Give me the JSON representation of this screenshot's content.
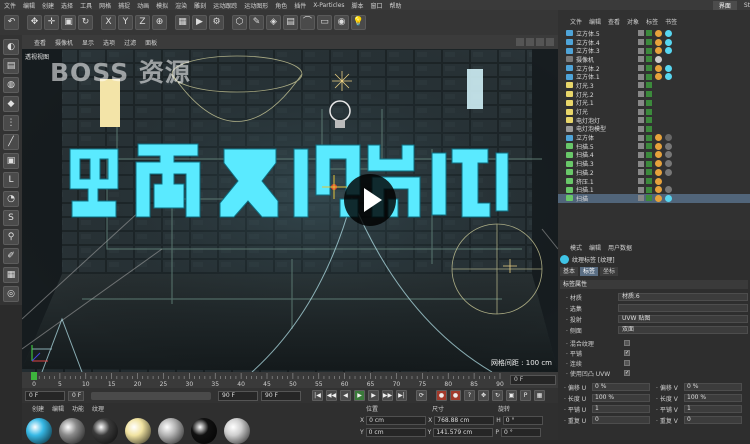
{
  "menubar": {
    "items": [
      "文件",
      "编辑",
      "创建",
      "选择",
      "工具",
      "网格",
      "捕捉",
      "动画",
      "模拟",
      "渲染",
      "雕刻",
      "运动跟踪",
      "运动图形",
      "角色",
      "插件",
      "X-Particles",
      "脚本",
      "窗口",
      "帮助"
    ],
    "layout_label": "界面",
    "layout_value": "St"
  },
  "toolbar": {
    "icons": [
      "undo-icon",
      "select-icon",
      "move-icon",
      "scale-icon",
      "rotate-icon",
      "axis-x-icon",
      "axis-y-icon",
      "axis-z-icon",
      "coordinate-icon",
      "render-region-icon",
      "render-view-icon",
      "render-settings-icon",
      "cube-icon",
      "spline-pen-icon",
      "subdivision-icon",
      "array-icon",
      "deformer-icon",
      "floor-icon",
      "camera-icon",
      "light-icon"
    ],
    "glyphs": [
      "↶",
      "✥",
      "✛",
      "▣",
      "↻",
      "X",
      "Y",
      "Z",
      "⊕",
      "▦",
      "▶",
      "⚙",
      "⬡",
      "✎",
      "◈",
      "▤",
      "⌒",
      "▭",
      "◉",
      "💡"
    ]
  },
  "left_tools": {
    "icons": [
      "make-editable-icon",
      "model-mode-icon",
      "texture-mode-icon",
      "workplane-icon",
      "points-mode-icon",
      "edges-mode-icon",
      "polygons-mode-icon",
      "axis-mode-icon",
      "tweak-icon",
      "snap-icon",
      "lock-workplane-icon",
      "paint-icon",
      "grid-icon",
      "solo-icon"
    ],
    "glyphs": [
      "◐",
      "▤",
      "◍",
      "◆",
      "⋮",
      "╱",
      "▣",
      "L",
      "◔",
      "S",
      "⚲",
      "✐",
      "▦",
      "◎"
    ]
  },
  "viewport": {
    "menu": [
      "查看",
      "摄像机",
      "显示",
      "选项",
      "过滤",
      "面板"
    ],
    "view_name": "透视视图",
    "watermark": "BOSS 资源",
    "title_text": "电商视觉",
    "grid_info": "网格间距 : 100 cm"
  },
  "timeline": {
    "ticks": [
      "0",
      "5",
      "10",
      "15",
      "20",
      "25",
      "30",
      "35",
      "40",
      "45",
      "50",
      "55",
      "60",
      "65",
      "70",
      "75",
      "80",
      "85",
      "90"
    ],
    "current_frame": "0 F"
  },
  "transport": {
    "start": "0 F",
    "preview_start": "0 F",
    "end": "90 F",
    "preview_end": "90 F"
  },
  "material_manager": {
    "menu": [
      "创建",
      "编辑",
      "功能",
      "纹理"
    ],
    "materials": [
      {
        "name": "cyan-glow-material",
        "color": "#37b9e6"
      },
      {
        "name": "gray-material",
        "color": "#8a8a8a"
      },
      {
        "name": "dark-metal-material",
        "color": "#3a3a3a"
      },
      {
        "name": "pale-yellow-material",
        "color": "#f1e3a1"
      },
      {
        "name": "chrome-material",
        "color": "#b5b5b5"
      },
      {
        "name": "black-material",
        "color": "#111111"
      },
      {
        "name": "silver-material",
        "color": "#cfcfcf"
      }
    ]
  },
  "coordinates": {
    "headers": [
      "位置",
      "尺寸",
      "旋转"
    ],
    "rows": [
      {
        "axis": "X",
        "pos": "0 cm",
        "size": "768.88 cm",
        "rot_axis": "H",
        "rot": "0 °"
      },
      {
        "axis": "Y",
        "pos": "0 cm",
        "size": "141.579 cm",
        "rot_axis": "P",
        "rot": "0 °"
      }
    ]
  },
  "object_manager": {
    "menu": [
      "文件",
      "编辑",
      "查看",
      "对象",
      "标签",
      "书签"
    ],
    "objects": [
      {
        "name": "立方体.5",
        "icon_color": "#4fa4d8",
        "tags": [
          "#e6a23c",
          "#58d6f0"
        ],
        "selected": false
      },
      {
        "name": "立方体.4",
        "icon_color": "#4fa4d8",
        "tags": [
          "#e6a23c",
          "#58d6f0"
        ],
        "selected": false
      },
      {
        "name": "立方体.3",
        "icon_color": "#4fa4d8",
        "tags": [
          "#e6a23c",
          "#58d6f0"
        ],
        "selected": false
      },
      {
        "name": "摄像机",
        "icon_color": "#7a7a7a",
        "tags": [
          "#cccccc"
        ],
        "selected": false
      },
      {
        "name": "立方体.2",
        "icon_color": "#4fa4d8",
        "tags": [
          "#e6a23c",
          "#58d6f0"
        ],
        "selected": false
      },
      {
        "name": "立方体.1",
        "icon_color": "#4fa4d8",
        "tags": [
          "#e6a23c",
          "#58d6f0"
        ],
        "selected": false
      },
      {
        "name": "灯光.3",
        "icon_color": "#e8d66a",
        "tags": [],
        "selected": false
      },
      {
        "name": "灯光.2",
        "icon_color": "#e8d66a",
        "tags": [],
        "selected": false
      },
      {
        "name": "灯光.1",
        "icon_color": "#e8d66a",
        "tags": [],
        "selected": false
      },
      {
        "name": "灯光",
        "icon_color": "#e8d66a",
        "tags": [],
        "selected": false
      },
      {
        "name": "电灯泡灯",
        "icon_color": "#e8d66a",
        "tags": [],
        "selected": false
      },
      {
        "name": "电灯泡模型",
        "icon_color": "#9a9a9a",
        "tags": [],
        "selected": false
      },
      {
        "name": "立方体",
        "icon_color": "#4fa4d8",
        "tags": [
          "#e6a23c",
          "#666666"
        ],
        "selected": false
      },
      {
        "name": "扫描.5",
        "icon_color": "#69c869",
        "tags": [
          "#e6a23c",
          "#777777"
        ],
        "selected": false
      },
      {
        "name": "扫描.4",
        "icon_color": "#69c869",
        "tags": [
          "#e6a23c",
          "#777777"
        ],
        "selected": false
      },
      {
        "name": "扫描.3",
        "icon_color": "#69c869",
        "tags": [
          "#e6a23c",
          "#777777"
        ],
        "selected": false
      },
      {
        "name": "扫描.2",
        "icon_color": "#69c869",
        "tags": [
          "#e6a23c",
          "#777777"
        ],
        "selected": false
      },
      {
        "name": "挤压.1",
        "icon_color": "#69c869",
        "tags": [
          "#e6a23c"
        ],
        "selected": false
      },
      {
        "name": "扫描.1",
        "icon_color": "#69c869",
        "tags": [
          "#e6a23c",
          "#777777"
        ],
        "selected": false
      },
      {
        "name": "扫描",
        "icon_color": "#69c869",
        "tags": [
          "#e6a23c",
          "#58d6f0"
        ],
        "selected": true
      }
    ]
  },
  "attribute_manager": {
    "menu": [
      "模式",
      "编辑",
      "用户数据"
    ],
    "title": "纹理标签 [纹理]",
    "tabs": [
      "基本",
      "标签",
      "坐标"
    ],
    "active_tab": "标签",
    "section": "标签属性",
    "rows": [
      {
        "label": "· 材质",
        "value": "材质.6"
      },
      {
        "label": "· 选集",
        "value": ""
      },
      {
        "label": "· 投射",
        "value": "UVW 贴图"
      },
      {
        "label": "· 侧面",
        "value": "双面"
      }
    ],
    "checks": [
      {
        "label": "· 混合纹理",
        "mark": ""
      },
      {
        "label": "· 平铺",
        "mark": "✓"
      },
      {
        "label": "· 连续",
        "mark": ""
      },
      {
        "label": "· 使用凹凸 UVW",
        "mark": "✓"
      }
    ],
    "uv_rows": [
      {
        "l1": "· 偏移 U",
        "v1": "0 %",
        "l2": "· 偏移 V",
        "v2": "0 %"
      },
      {
        "l1": "· 长度 U",
        "v1": "100 %",
        "l2": "· 长度 V",
        "v2": "100 %"
      },
      {
        "l1": "· 平铺 U",
        "v1": "1",
        "l2": "· 平铺 V",
        "v2": "1"
      },
      {
        "l1": "· 重复 U",
        "v1": "0",
        "l2": "· 重复 V",
        "v2": "0"
      }
    ]
  }
}
